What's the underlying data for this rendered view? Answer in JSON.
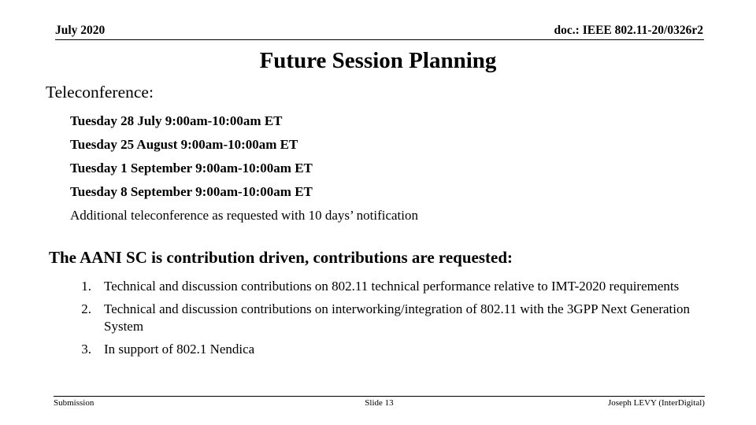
{
  "header": {
    "left": "July 2020",
    "right": "doc.: IEEE 802.11-20/0326r2"
  },
  "title": "Future Session Planning",
  "sections": {
    "teleconference": {
      "heading": "Teleconference:",
      "items": [
        "Tuesday 28 July 9:00am-10:00am ET",
        "Tuesday 25 August 9:00am-10:00am ET",
        "Tuesday 1 September 9:00am-10:00am ET",
        "Tuesday 8 September 9:00am-10:00am ET"
      ],
      "note": "Additional teleconference as requested with 10 days’ notification"
    },
    "contributions": {
      "heading": "The AANI SC is contribution driven, contributions are requested:",
      "items": [
        {
          "marker": "1.",
          "text": "Technical and discussion contributions on 802.11 technical performance relative to IMT-2020 requirements"
        },
        {
          "marker": "2.",
          "text": "Technical and discussion contributions on interworking/integration of 802.11 with the 3GPP Next Generation System"
        },
        {
          "marker": "3.",
          "text": "In support of 802.1 Nendica"
        }
      ]
    }
  },
  "footer": {
    "left": "Submission",
    "center": "Slide 13",
    "right": "Joseph LEVY (InterDigital)"
  }
}
